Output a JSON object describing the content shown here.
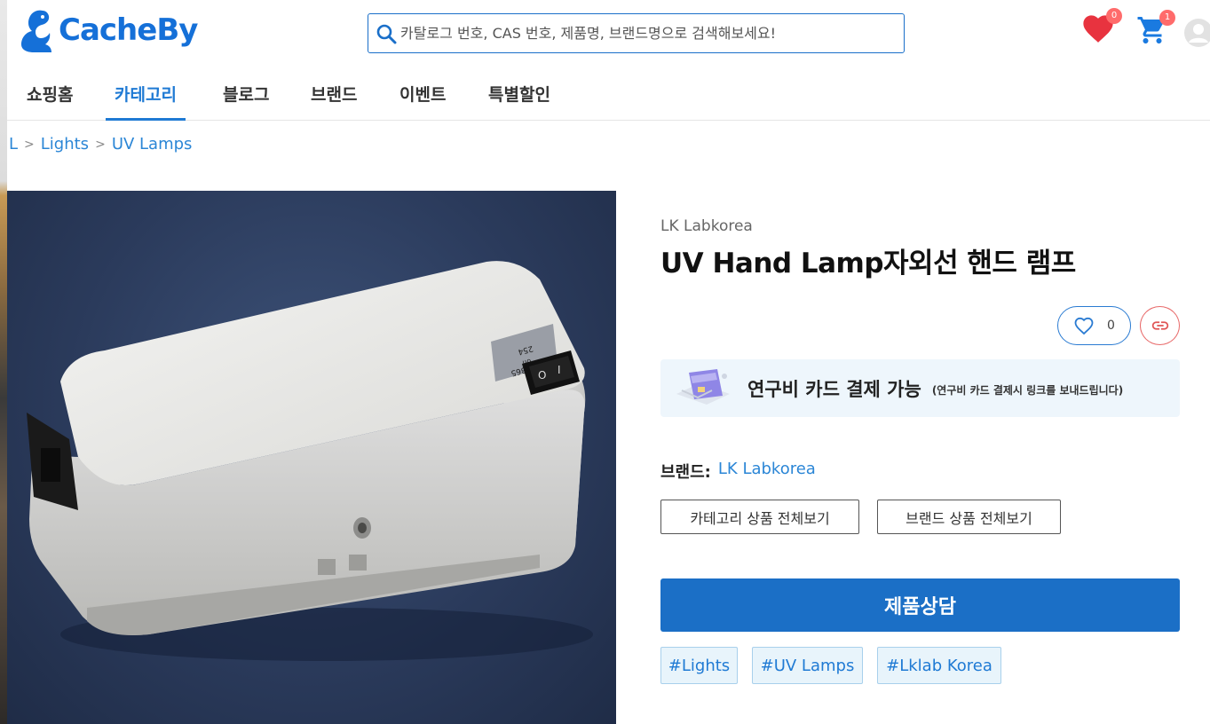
{
  "header": {
    "logo_text": "CacheBy",
    "search_placeholder": "카탈로그 번호, CAS 번호, 제품명, 브랜드명으로 검색해보세요!",
    "wishlist_count": "0",
    "cart_count": "1",
    "brand_color": "#1570d8",
    "wishlist_color": "#e8333f",
    "badge_color": "#ff6b6b"
  },
  "nav": {
    "items": [
      {
        "label": "쇼핑홈",
        "active": false
      },
      {
        "label": "카테고리",
        "active": true
      },
      {
        "label": "블로그",
        "active": false
      },
      {
        "label": "브랜드",
        "active": false
      },
      {
        "label": "이벤트",
        "active": false
      },
      {
        "label": "특별할인",
        "active": false
      }
    ]
  },
  "breadcrumb": {
    "items": [
      "L",
      "Lights",
      "UV Lamps"
    ],
    "separator": ">"
  },
  "product": {
    "brand_small": "LK Labkorea",
    "title": "UV Hand Lamp자외선 핸드 램프",
    "like_count": "0",
    "card_banner_main": "연구비 카드 결제 가능",
    "card_banner_sub": "(연구비 카드 결제시 링크를 보내드립니다)",
    "brand_label": "브랜드:",
    "brand_value": "LK Labkorea",
    "category_all_button": "카테고리 상품 전체보기",
    "brand_all_button": "브랜드 상품 전체보기",
    "inquiry_button": "제품상담",
    "tags": [
      "#Lights",
      "#UV Lamps",
      "#Lklab Korea"
    ],
    "image_labels": {
      "switch_top": "254",
      "switch_mid": "off",
      "switch_bottom": "365"
    },
    "primary_color": "#1b6fc6"
  },
  "icons": {
    "search": "search-icon",
    "wishlist": "heart-icon",
    "cart": "cart-icon",
    "user": "user-avatar-icon",
    "like": "heart-outline-icon",
    "share": "link-icon",
    "card": "credit-card-icon"
  }
}
